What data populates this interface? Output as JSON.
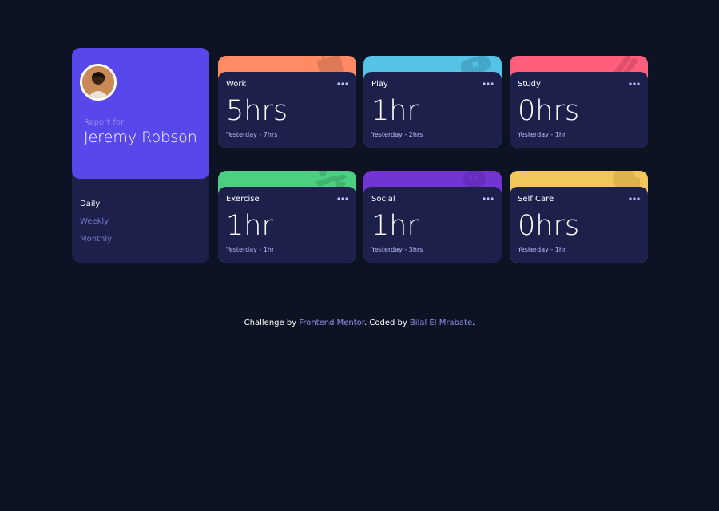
{
  "profile": {
    "report_for": "Report for",
    "name": "Jeremy Robson",
    "periods": [
      "Daily",
      "Weekly",
      "Monthly"
    ],
    "active_period": "Daily"
  },
  "cards": [
    {
      "title": "Work",
      "current": "5hrs",
      "previous": "Yesterday - 7hrs",
      "color": "#ff8b64",
      "icon": "briefcase-icon"
    },
    {
      "title": "Play",
      "current": "1hr",
      "previous": "Yesterday - 2hrs",
      "color": "#55c2e6",
      "icon": "gamepad-icon"
    },
    {
      "title": "Study",
      "current": "0hrs",
      "previous": "Yesterday - 1hr",
      "color": "#ff5e7d",
      "icon": "book-icon"
    },
    {
      "title": "Exercise",
      "current": "1hr",
      "previous": "Yesterday - 1hr",
      "color": "#4bcf82",
      "icon": "running-icon"
    },
    {
      "title": "Social",
      "current": "1hr",
      "previous": "Yesterday - 3hrs",
      "color": "#7335d2",
      "icon": "chat-bubble-icon"
    },
    {
      "title": "Self Care",
      "current": "0hrs",
      "previous": "Yesterday - 1hr",
      "color": "#f1c75b",
      "icon": "heart-icon"
    }
  ],
  "footer": {
    "prefix": "Challenge by",
    "link1": "Frontend Mentor",
    "middle": ". Coded by",
    "link2": "Bilal El Mrabate",
    "suffix": "."
  }
}
